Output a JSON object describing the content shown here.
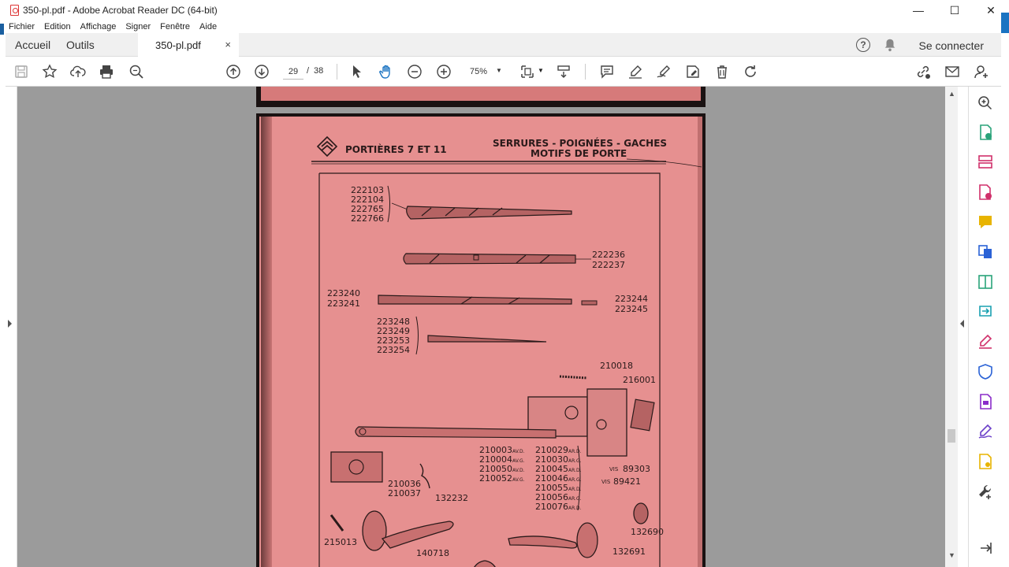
{
  "window": {
    "title": "350-pl.pdf - Adobe Acrobat Reader DC (64-bit)",
    "minimize": "—",
    "maximize": "☐",
    "close": "✕"
  },
  "menu": [
    "Fichier",
    "Edition",
    "Affichage",
    "Signer",
    "Fenêtre",
    "Aide"
  ],
  "tabs": {
    "home": "Accueil",
    "tools": "Outils",
    "document": "350-pl.pdf",
    "close": "×",
    "help": "?",
    "connect": "Se connecter"
  },
  "toolbar": {
    "page_current": "29",
    "page_separator": "/",
    "page_total": "38",
    "zoom": "75%"
  },
  "document": {
    "header_title": "PORTIÈRES 7 ET 11",
    "header_right_1": "SERRURES - POIGNÉES - GACHES",
    "header_right_2": "MOTIFS DE PORTE",
    "parts": {
      "group1": [
        "222103",
        "222104",
        "222765",
        "222766"
      ],
      "group2": [
        "222236",
        "222237"
      ],
      "group3a": [
        "223240",
        "223241"
      ],
      "group3b": [
        "223244",
        "223245"
      ],
      "group4": [
        "223248",
        "223249",
        "223253",
        "223254"
      ],
      "p210018": "210018",
      "p216001": "216001",
      "group5": [
        "210003",
        "210004",
        "210050",
        "210052"
      ],
      "group5_suffix": [
        "AV.D.",
        "AV.G.",
        "AV.D.",
        "AV.G."
      ],
      "group6": [
        "210029",
        "210030",
        "210045",
        "210046",
        "210055",
        "210056",
        "210076"
      ],
      "group6_suffix": [
        "AR.D.",
        "AR.G.",
        "AR.D.",
        "AR.G.",
        "AR.D.",
        "AR.G.",
        "AR.D."
      ],
      "p89303": "89303",
      "p89421": "89421",
      "p89303_prefix": "VIS",
      "p89421_prefix": "VIS",
      "group7": [
        "210036",
        "210037"
      ],
      "p132232": "132232",
      "p215013": "215013",
      "p140718": "140718",
      "p132690": "132690",
      "p132691": "132691"
    }
  },
  "colors": {
    "page_pink": "#e69090",
    "viewer_gray": "#9b9b9b",
    "accent_blue": "#1a73c2"
  }
}
